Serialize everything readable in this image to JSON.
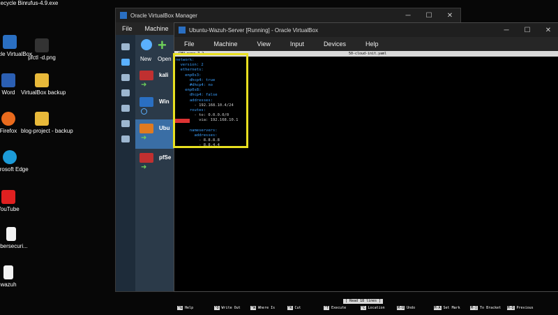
{
  "desktop": {
    "icons": [
      {
        "label": "Recycle Bin",
        "color": "#aab4c0"
      },
      {
        "label": "rufus-4.9.exe",
        "color": "#8fa0b5"
      },
      {
        "label": "Oracle VirtualBox",
        "color": "#2a6fc2"
      },
      {
        "label": "pfctl -d.png",
        "color": "#333333"
      },
      {
        "label": "Word",
        "color": "#2b5fb3"
      },
      {
        "label": "VirtualBox backup",
        "color": "#e8b93a"
      },
      {
        "label": "Firefox",
        "color": "#e96a1d"
      },
      {
        "label": "blog-project - backup",
        "color": "#e8b93a"
      },
      {
        "label": "Microsoft Edge",
        "color": "#1c9bd8"
      },
      {
        "label": "YouTube",
        "color": "#e02020"
      },
      {
        "label": "cybersecuri...",
        "color": "#f2f2f2"
      },
      {
        "label": "wazuh",
        "color": "#f2f2f2"
      }
    ]
  },
  "manager": {
    "title": "Oracle VirtualBox Manager",
    "menu": [
      "File",
      "Machine"
    ],
    "tools": {
      "new": "New",
      "open": "Open"
    },
    "vms": [
      {
        "name": "kali",
        "os_badge": "x64"
      },
      {
        "name": "Win",
        "os_badge": "x64"
      },
      {
        "name": "Ubu",
        "os_badge": "x64"
      },
      {
        "name": "pfSe",
        "os_badge": "x64"
      }
    ]
  },
  "vmwindow": {
    "title": "Ubuntu-Wazuh-Server [Running] - Oracle VirtualBox",
    "menu": [
      "File",
      "Machine",
      "View",
      "Input",
      "Devices",
      "Help"
    ]
  },
  "nano": {
    "header_left": "GNU nano 7.2",
    "header_file": "50-cloud-init.yaml",
    "lines": [
      {
        "text": "network:",
        "color": "#3aa0ff"
      },
      {
        "text": "  version: 2",
        "color": "#3aa0ff",
        "tail": "",
        "tail_color": "#e040e0"
      },
      {
        "text": "  ethernets:",
        "color": "#3aa0ff"
      },
      {
        "text": "    enp0s3:",
        "color": "#3aa0ff"
      },
      {
        "text": "      dhcp4: true",
        "color": "#3aa0ff"
      },
      {
        "text": "      #dhcp4: no",
        "color": "#3aa0ff"
      },
      {
        "text": "    enp0s8:",
        "color": "#3aa0ff"
      },
      {
        "text": "      dhcp4: false",
        "color": "#3aa0ff"
      },
      {
        "text": "      addresses:",
        "color": "#3aa0ff"
      },
      {
        "text": "        - 192.168.10.4/24",
        "color": "#cfcfcf"
      },
      {
        "text": "      routes:",
        "color": "#3aa0ff"
      },
      {
        "text": "        - to: 0.0.0.0/0",
        "color": "#cfcfcf"
      },
      {
        "text": "          via: 192.168.10.1",
        "color": "#cfcfcf"
      },
      {
        "text": "",
        "color": "#cfcfcf"
      },
      {
        "text": "      nameservers:",
        "color": "#3aa0ff"
      },
      {
        "text": "        addresses:",
        "color": "#3aa0ff"
      },
      {
        "text": "          - 8.8.8.8",
        "color": "#cfcfcf"
      },
      {
        "text": "          - 8.8.4.4",
        "color": "#cfcfcf"
      }
    ],
    "status": "[ Read 18 lines ]",
    "shortcuts": [
      {
        "key": "^G",
        "label": "Help"
      },
      {
        "key": "^O",
        "label": "Write Out"
      },
      {
        "key": "^W",
        "label": "Where Is"
      },
      {
        "key": "^K",
        "label": "Cut"
      },
      {
        "key": "^T",
        "label": "Execute"
      },
      {
        "key": "^C",
        "label": "Location"
      },
      {
        "key": "M-U",
        "label": "Undo"
      },
      {
        "key": "M-A",
        "label": "Set Mark"
      },
      {
        "key": "M-]",
        "label": "To Bracket"
      },
      {
        "key": "M-Q",
        "label": "Previous"
      }
    ]
  },
  "highlight_color": "#e8e020"
}
